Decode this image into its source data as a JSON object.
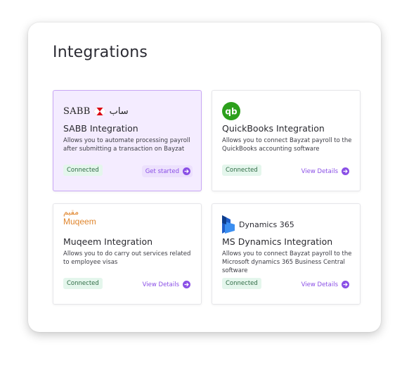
{
  "page": {
    "title": "Integrations"
  },
  "colors": {
    "accent": "#8a4fe6",
    "connected_bg": "#e4f6ec",
    "selected_bg": "#f4ecff"
  },
  "cards": [
    {
      "logo": {
        "text": "SABB",
        "arabic": "ساب",
        "icon": "sabb-hexagon-icon"
      },
      "title": "SABB Integration",
      "description": "Allows you to automate processing payroll after submitting a transaction on Bayzat",
      "status": "Connected",
      "action": "Get started",
      "selected": true
    },
    {
      "logo": {
        "icon": "quickbooks-logo-icon"
      },
      "title": "QuickBooks Integration",
      "description": "Allows you to connect Bayzat payroll to the QuickBooks accounting software",
      "status": "Connected",
      "action": "View Details",
      "selected": false
    },
    {
      "logo": {
        "arabic": "مقيم",
        "text": "Muqeem"
      },
      "title": "Muqeem Integration",
      "description": "Allows you to do carry out services related to employee visas",
      "status": "Connected",
      "action": "View Details",
      "selected": false
    },
    {
      "logo": {
        "text": "Dynamics 365",
        "icon": "dynamics-365-logo-icon"
      },
      "title": "MS Dynamics Integration",
      "description": "Allows you to connect Bayzat payroll to the Microsoft dynamics 365 Business Central software",
      "status": "Connected",
      "action": "View Details",
      "selected": false
    }
  ]
}
